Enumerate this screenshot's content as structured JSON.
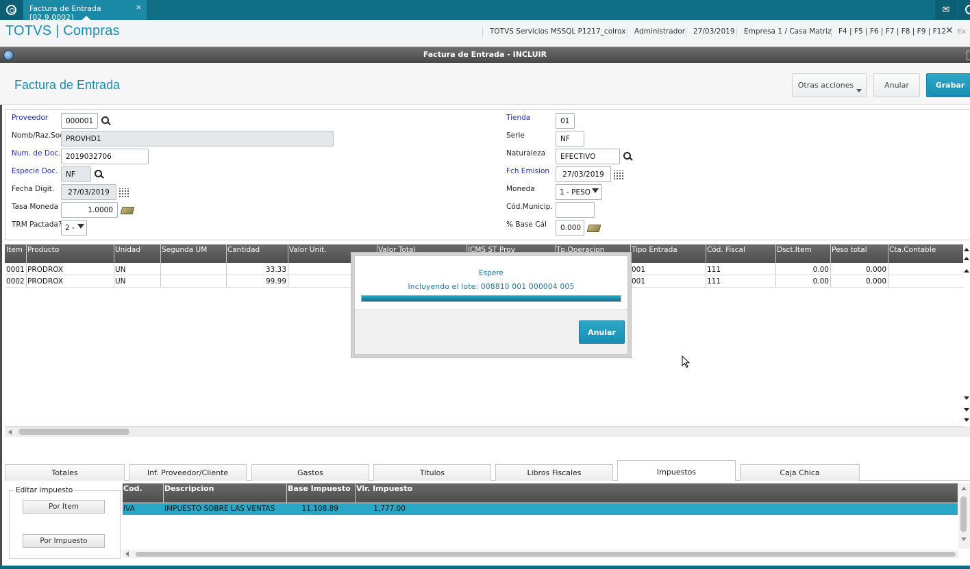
{
  "tabbar": {
    "active_tab": "Factura de Entrada [02.9.0002]",
    "close_glyph": "×"
  },
  "header": {
    "app_title": "TOTVS | Compras",
    "environment": "TOTVS Servicios MSSQL P1217_colrox",
    "user": "Administrador",
    "date": "27/03/2019",
    "company": "Empresa 1 / Casa Matriz",
    "shortcuts": "F4 | F5 | F6 | F7 | F8 | F9 | F12",
    "exit_label": "Ex"
  },
  "window": {
    "title": "Factura de Entrada - INCLUIR"
  },
  "form": {
    "title": "Factura de Entrada",
    "buttons": {
      "otras": "Otras acciones",
      "anular": "Anular",
      "grabar": "Grabar"
    },
    "left_fields": {
      "proveedor": {
        "label": "Proveedor",
        "value": "000001"
      },
      "nomb": {
        "label": "Nomb/Raz.Soc",
        "value": "PROVHD1"
      },
      "numdoc": {
        "label": "Num. de Doc.",
        "value": "2019032706"
      },
      "especie": {
        "label": "Especie Doc.",
        "value": "NF"
      },
      "fecha_digit": {
        "label": "Fecha Digit.",
        "value": "27/03/2019"
      },
      "tasa": {
        "label": "Tasa Moneda",
        "value": "1.0000"
      },
      "trm": {
        "label": "TRM Pactada?",
        "value": "2 -"
      }
    },
    "right_fields": {
      "tienda": {
        "label": "Tienda",
        "value": "01"
      },
      "serie": {
        "label": "Serie",
        "value": "NF"
      },
      "naturaleza": {
        "label": "Naturaleza",
        "value": "EFECTIVO"
      },
      "fch_emision": {
        "label": "Fch Emision",
        "value": "27/03/2019"
      },
      "moneda": {
        "label": "Moneda",
        "value": "1 - PESO"
      },
      "cod_municip": {
        "label": "Cód.Municip.",
        "value": ""
      },
      "base_cal": {
        "label": "% Base Cál",
        "value": "0.000"
      }
    }
  },
  "grid": {
    "columns": [
      "Item",
      "Producto",
      "Unidad",
      "Segunda UM",
      "Cantidad",
      "Valor Unit.",
      "Valor Total",
      "ICMS ST Prov",
      "Tp.Operacion",
      "Tipo Entrada",
      "Cód. Fiscal",
      "Dsct.Item",
      "Peso total",
      "Cta.Contable"
    ],
    "rows": [
      {
        "item": "0001",
        "producto": "PRODROX",
        "unidad": "UN",
        "cantidad": "33.33",
        "tipo_entrada": "001",
        "cod_fiscal": "111",
        "dsct": "0.00",
        "peso": "0.000"
      },
      {
        "item": "0002",
        "producto": "PRODROX",
        "unidad": "UN",
        "cantidad": "99.99",
        "tipo_entrada": "001",
        "cod_fiscal": "111",
        "dsct": "0.00",
        "peso": "0.000"
      }
    ]
  },
  "modal": {
    "title": "Espere",
    "message": "Incluyendo el lote: 008810 001 000004 005",
    "progress_fraction": 1.0,
    "button": "Anular"
  },
  "bottom_tabs": [
    "Totales",
    "Inf. Proveedor/Cliente",
    "Gastos",
    "Titulos",
    "Libros Fiscales",
    "Impuestos",
    "Caja Chica"
  ],
  "bottom_active_tab": "Impuestos",
  "impuestos": {
    "group_title": "Editar impuesto",
    "btn_item": "Por Item",
    "btn_impuesto": "Por Impuesto",
    "columns": [
      "Cod.",
      "Descripcion",
      "Base Impuesto",
      "Vlr. Impuesto"
    ],
    "rows": [
      {
        "cod": "IVA",
        "descripcion": "IMPUESTO SOBRE LAS VENTAS",
        "base": "11,108.89",
        "valor": "1,777.00"
      }
    ]
  },
  "colors": {
    "brand": "#0f6d86",
    "accent": "#1b8db0",
    "selected_row": "#2aa6c7"
  },
  "icons": [
    "home-icon",
    "mail-icon",
    "help-icon",
    "search-icon",
    "calendar-icon",
    "money-icon",
    "dropdown-icon",
    "close-icon"
  ]
}
